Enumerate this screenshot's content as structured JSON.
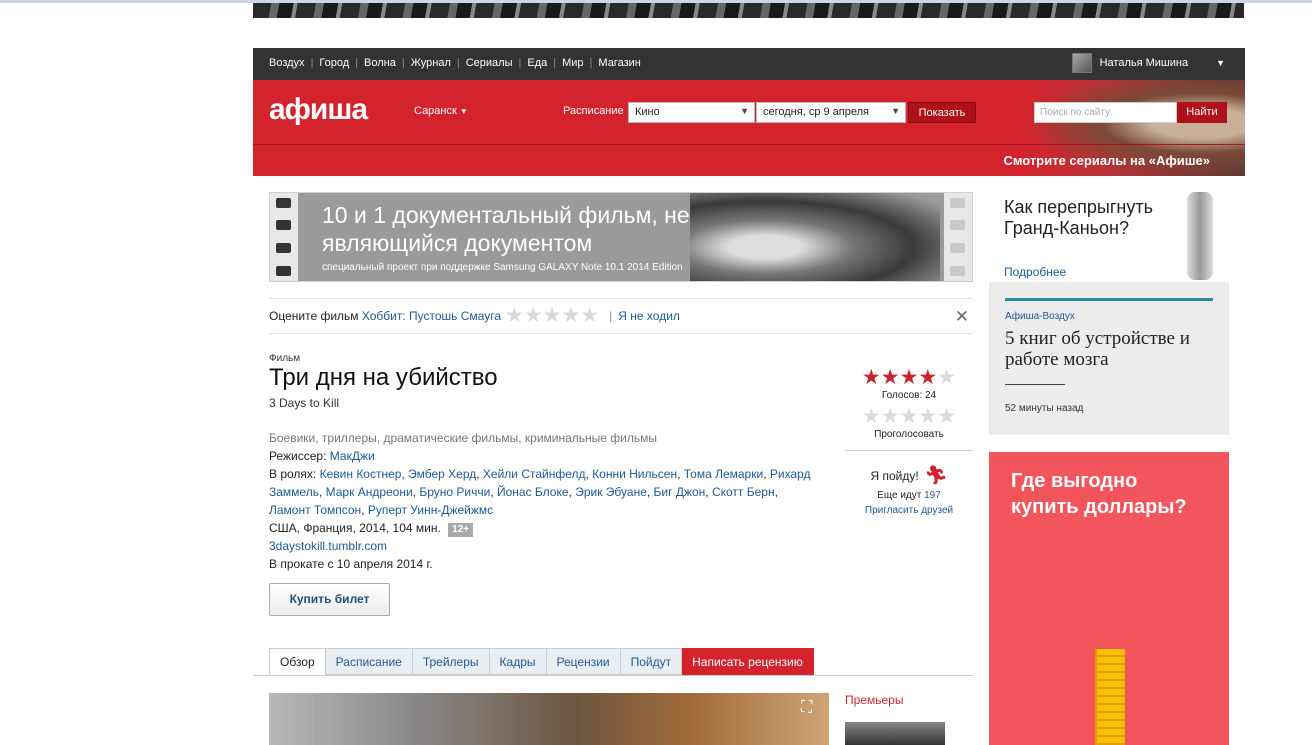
{
  "nav": {
    "items": [
      "Воздух",
      "Город",
      "Волна",
      "Журнал",
      "Сериалы",
      "Еда",
      "Мир",
      "Магазин"
    ],
    "user_name": "Наталья Мишина"
  },
  "header": {
    "logo": "афиша",
    "city": "Саранск",
    "schedule_label": "Расписание",
    "category_select": "Кино",
    "date_select": "сегодня, ср 9 апреля",
    "show_button": "Показать",
    "search_placeholder": "Поиск по сайту",
    "search_button": "Найти",
    "serials_promo": "Смотрите сериалы на «Афише»"
  },
  "banner": {
    "title": "10 и 1 документальный фильм, не являющийся документом",
    "subtitle": "специальный проект при поддержке Samsung GALAXY Note 10.1 2014 Edition"
  },
  "rate_prompt": {
    "label": "Оцените фильм",
    "film_link": "Хоббит: Пустошь Смауга",
    "not_watched": "Я не ходил",
    "stars": 5
  },
  "film": {
    "kind": "Фильм",
    "title": "Три дня на убийство",
    "original_title": "3 Days to Kill",
    "genres": "Боевики, триллеры, драматические фильмы, криминальные фильмы",
    "director_label": "Режиссер:",
    "director": "МакДжи",
    "cast_label": "В ролях:",
    "cast": [
      "Кевин Костнер",
      "Эмбер Херд",
      "Хейли Стайнфелд",
      "Конни Нильсен",
      "Тома Лемарки",
      "Рихард Заммель",
      "Марк Андреони",
      "Бруно Риччи",
      "Йонас Блоке",
      "Эрик Эбуане",
      "Биг Джон",
      "Скотт Берн",
      "Ламонт Томпсон",
      "Руперт Уинн-Джейжмс"
    ],
    "country_year": "США, Франция, 2014, 104 мин.",
    "age_rating": "12+",
    "site": "3daystokill.tumblr.com",
    "release": "В прокате с 10 апреля 2014 г.",
    "buy_button": "Купить билет"
  },
  "rating": {
    "score_stars": 4,
    "max_stars": 5,
    "votes_label": "Голосов: 24",
    "vote_link": "Проголосовать",
    "going_label": "Я пойду!",
    "also_going_label": "Еще идут",
    "also_going_count": "197",
    "invite_link": "Пригласить друзей"
  },
  "tabs": [
    "Обзор",
    "Расписание",
    "Трейлеры",
    "Кадры",
    "Рецензии",
    "Пойдут",
    "Написать рецензию"
  ],
  "premieres_label": "Премьеры",
  "ad1": {
    "text": "Как перепрыгнуть Гранд-Каньон?",
    "link": "Подробнее"
  },
  "vozduh": {
    "source": "Афиша-Воздух",
    "headline": "5 книг об устройстве и работе мозга",
    "time": "52 минуты назад"
  },
  "ad2": {
    "text": "Где выгодно купить доллары?"
  },
  "colors": {
    "brand_red": "#d3242d",
    "link_blue": "#1e5a96",
    "dark_nav": "#333333",
    "ad_red": "#f2555c"
  }
}
